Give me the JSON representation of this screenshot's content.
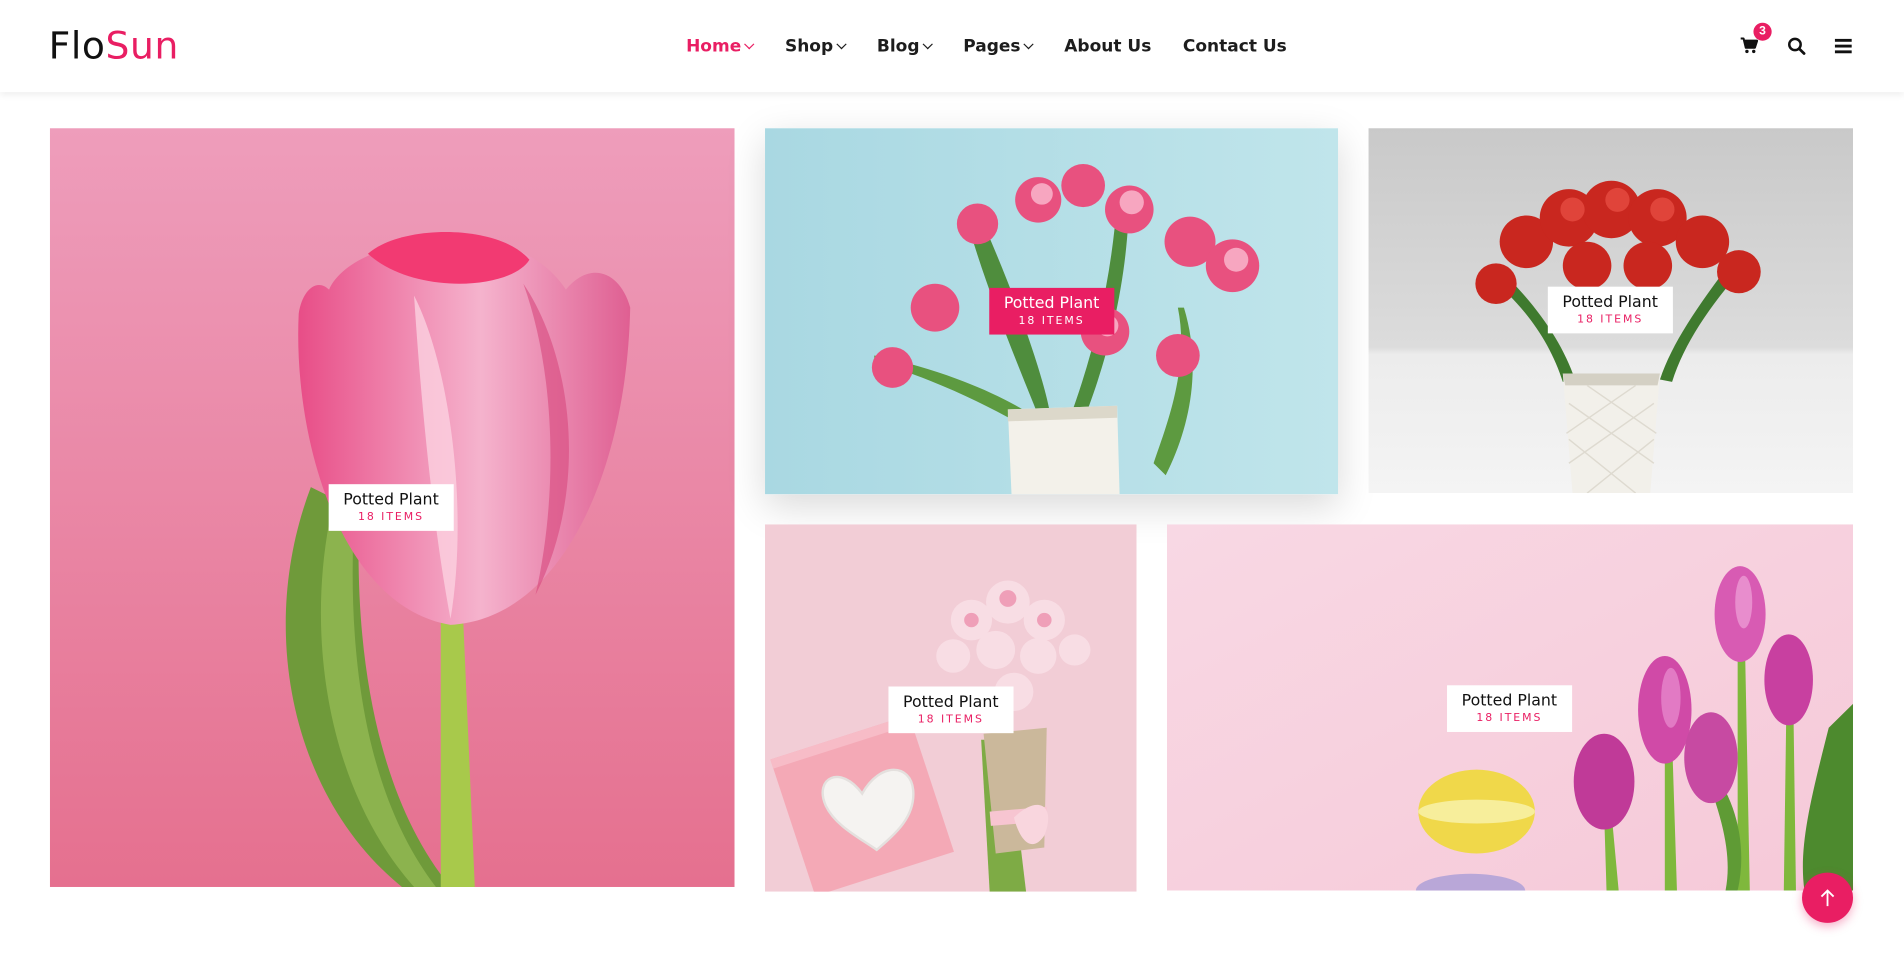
{
  "brand": {
    "part1": "Flo",
    "part2": "Sun",
    "accent_color": "#e91e63"
  },
  "nav": {
    "items": [
      {
        "label": "Home",
        "has_dropdown": true,
        "active": true
      },
      {
        "label": "Shop",
        "has_dropdown": true,
        "active": false
      },
      {
        "label": "Blog",
        "has_dropdown": true,
        "active": false
      },
      {
        "label": "Pages",
        "has_dropdown": true,
        "active": false
      },
      {
        "label": "About Us",
        "has_dropdown": false,
        "active": false
      },
      {
        "label": "Contact Us",
        "has_dropdown": false,
        "active": false
      }
    ]
  },
  "header_icons": {
    "cart": {
      "icon": "shopping-cart-icon",
      "count": "3"
    },
    "search": {
      "icon": "search-icon"
    },
    "menu": {
      "icon": "hamburger-menu-icon"
    }
  },
  "categories": [
    {
      "title": "Potted Plant",
      "count": "18 ITEMS",
      "image": "pink tulip close-up on pink background"
    },
    {
      "title": "Potted Plant",
      "count": "18 ITEMS",
      "image": "pink tulips in white vase on light blue background"
    },
    {
      "title": "Potted Plant",
      "count": "18 ITEMS",
      "image": "red tulips in white textured vase"
    },
    {
      "title": "Potted Plant",
      "count": "18 ITEMS",
      "image": "pink tulip bouquet with gift box and felt heart"
    },
    {
      "title": "Potted Plant",
      "count": "18 ITEMS",
      "image": "purple tulips with macarons on pink background"
    }
  ],
  "scroll_top": {
    "icon": "arrow-up-icon"
  }
}
